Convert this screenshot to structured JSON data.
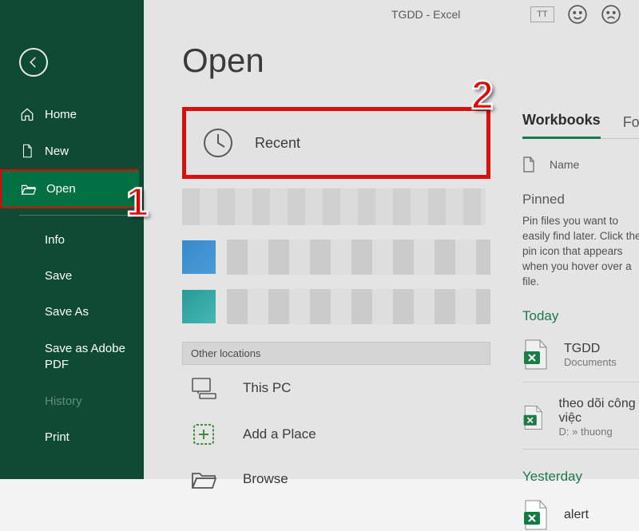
{
  "header": {
    "title": "TGDD  -  Excel",
    "avatar_initials": "TT"
  },
  "page_title": "Open",
  "sidebar": {
    "items": [
      {
        "label": "Home"
      },
      {
        "label": "New"
      },
      {
        "label": "Open"
      }
    ],
    "sub_items": [
      {
        "label": "Info"
      },
      {
        "label": "Save"
      },
      {
        "label": "Save As"
      },
      {
        "label": "Save as Adobe PDF"
      },
      {
        "label": "History",
        "disabled": true
      },
      {
        "label": "Print"
      }
    ]
  },
  "sources": {
    "recent": "Recent",
    "other_header": "Other locations",
    "this_pc": "This PC",
    "add_place": "Add a Place",
    "browse": "Browse"
  },
  "right": {
    "tabs": {
      "workbooks": "Workbooks",
      "folders": "Folders"
    },
    "col_name": "Name",
    "pinned_title": "Pinned",
    "pinned_help": "Pin files you want to easily find later. Click the pin icon that appears when you hover over a file.",
    "today_title": "Today",
    "files_today": [
      {
        "name": "TGDD",
        "sub": "Documents"
      },
      {
        "name": "theo dõi công việc",
        "sub": "D: » thuong"
      }
    ],
    "yesterday_title": "Yesterday",
    "files_yesterday": [
      {
        "name": "alert",
        "sub": ""
      }
    ]
  },
  "annotations": {
    "one": "1",
    "two": "2"
  }
}
